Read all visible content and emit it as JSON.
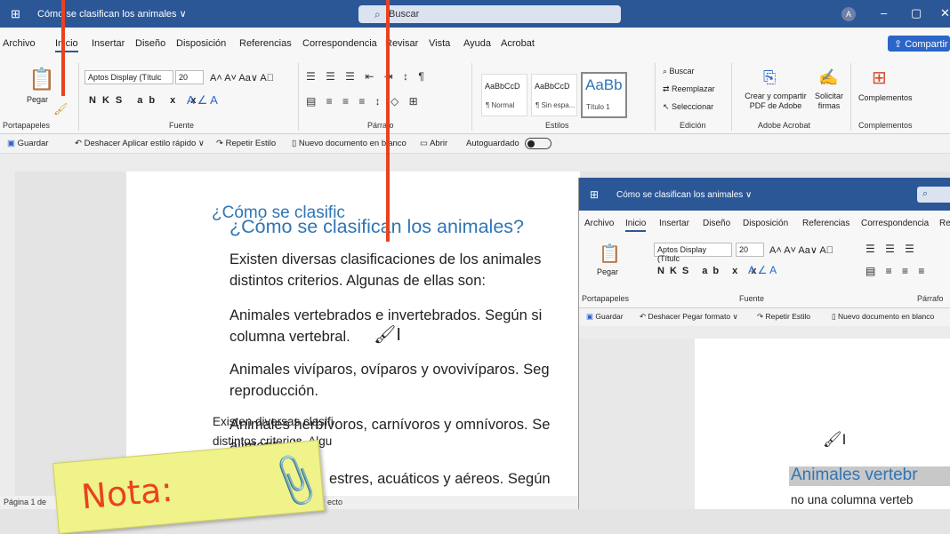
{
  "main_window": {
    "title": "Cómo se clasifican los animales ∨",
    "search_placeholder": "Buscar",
    "avatar_initial": "A",
    "menu": [
      "Archivo",
      "Inicio",
      "Insertar",
      "Diseño",
      "Disposición",
      "Referencias",
      "Correspondencia",
      "Revisar",
      "Vista",
      "Ayuda",
      "Acrobat"
    ],
    "share": "Compartir",
    "ribbon": {
      "paste": "Pegar",
      "font_name": "Aptos Display (Títulc",
      "font_size": "20",
      "styles": [
        {
          "sample": "AaBbCcD",
          "name": "¶ Normal"
        },
        {
          "sample": "AaBbCcD",
          "name": "¶ Sin espa..."
        },
        {
          "sample": "AaBb",
          "name": "Título 1"
        }
      ],
      "find": "Buscar",
      "replace": "Reemplazar",
      "select": "Seleccionar",
      "acrobat_create": "Crear y compartir PDF de Adobe",
      "acrobat_sign": "Solicitar firmas",
      "addins": "Complementos",
      "group_labels": [
        "Portapapeles",
        "Fuente",
        "Párrafo",
        "Estilos",
        "Edición",
        "Adobe Acrobat",
        "Complementos"
      ]
    },
    "qat": [
      "Guardar",
      "Deshacer Aplicar estilo rápido",
      "Repetir Estilo",
      "Nuevo documento en blanco",
      "Abrir",
      "Autoguardado"
    ],
    "doc": {
      "heading": "¿Cómo se clasifican los animales?",
      "paragraphs": [
        "Existen diversas clasificaciones de los animales",
        "distintos criterios. Algunas de ellas son:",
        "Animales vertebrados e invertebrados. Según si",
        "columna vertebral.",
        "Animales vivíparos, ovíparos y ovovivíparos. Seg",
        "reproducción.",
        "Animales herbívoros, carnívoros y omnívoros. Se",
        "alimentación.",
        "estres, acuáticos y aéreos. Según"
      ]
    },
    "status_page": "Página 1 de",
    "status_right": "ecto"
  },
  "second_window": {
    "title": "Cómo se clasifican los animales ∨",
    "menu": [
      "Archivo",
      "Inicio",
      "Insertar",
      "Diseño",
      "Disposición",
      "Referencias",
      "Correspondencia",
      "Re"
    ],
    "font_name": "Aptos Display (Títulc",
    "font_size": "20",
    "paste": "Pegar",
    "group_labels": [
      "Portapapeles",
      "Fuente",
      "Párrafo"
    ],
    "qat": [
      "Guardar",
      "Deshacer Pegar formato",
      "Repetir Estilo",
      "Nuevo documento en blanco"
    ],
    "heading": "¿Cómo se clasific",
    "lines": [
      "Existen diversas clasifi",
      "distintos criterios. Algu"
    ],
    "selected": "Animales vertebr",
    "last_line": "no una columna verteb"
  },
  "note": "Nota:"
}
